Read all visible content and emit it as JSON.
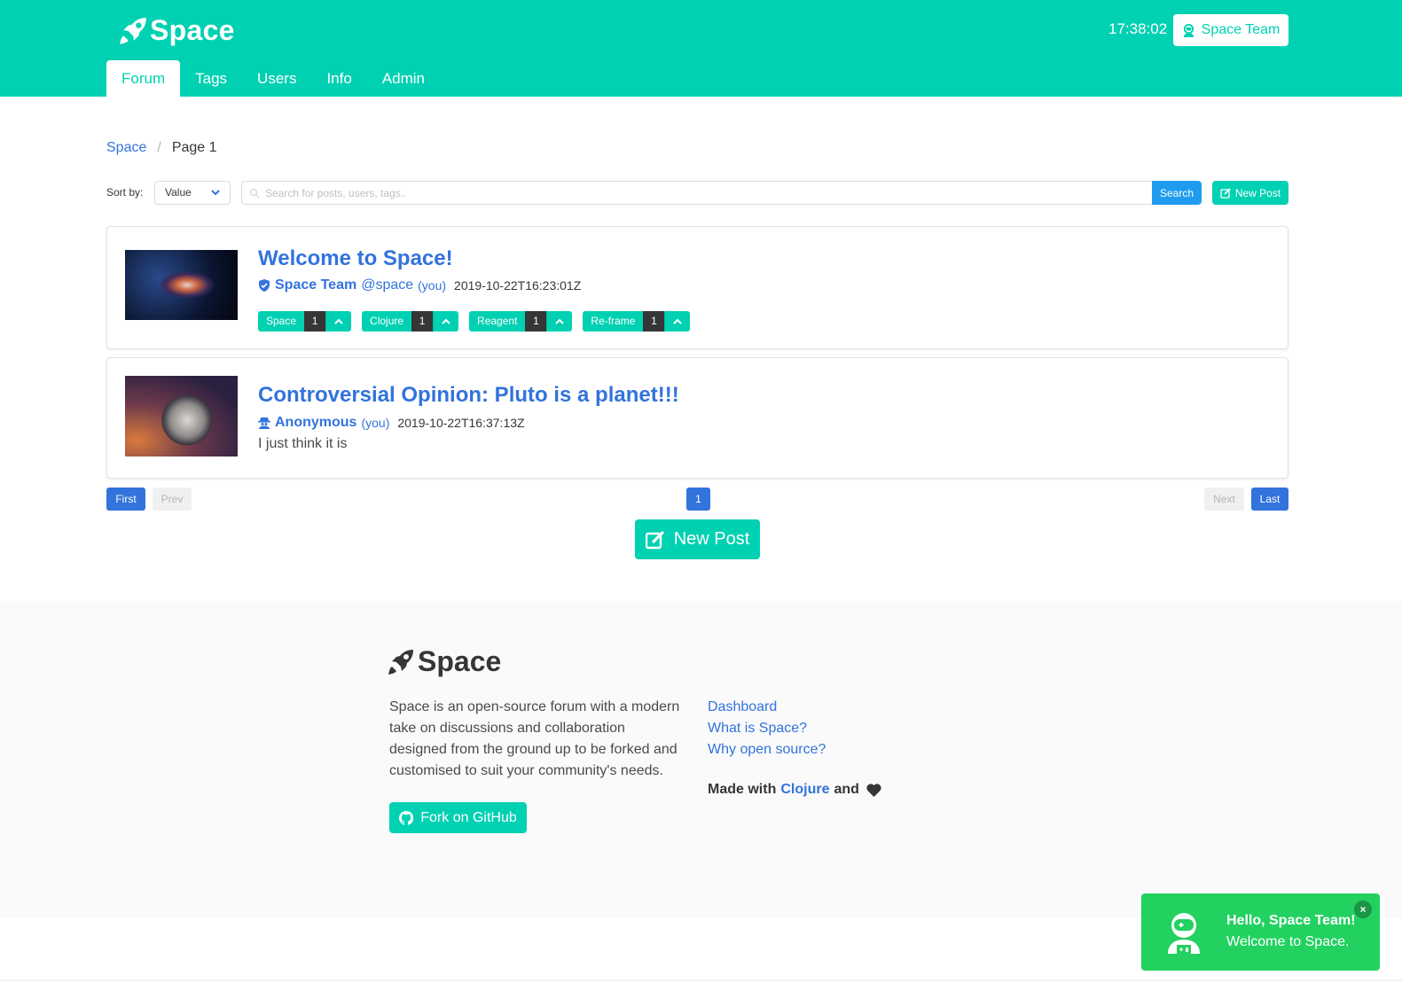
{
  "header": {
    "brand": "Space",
    "clock": "17:38:02",
    "user_button": "Space Team",
    "tabs": [
      {
        "label": "Forum",
        "active": true
      },
      {
        "label": "Tags"
      },
      {
        "label": "Users"
      },
      {
        "label": "Info"
      },
      {
        "label": "Admin"
      }
    ]
  },
  "breadcrumb": {
    "root": "Space",
    "separator": "/",
    "current": "Page 1"
  },
  "toolbar": {
    "sort_label": "Sort by:",
    "sort_value": "Value",
    "search_placeholder": "Search for posts, users, tags..",
    "search_button": "Search",
    "new_post": "New Post"
  },
  "posts": [
    {
      "title": "Welcome to Space!",
      "author": "Space Team",
      "handle": "@space",
      "you": "(you)",
      "timestamp": "2019-10-22T16:23:01Z",
      "tags": [
        {
          "name": "Space",
          "count": "1"
        },
        {
          "name": "Clojure",
          "count": "1"
        },
        {
          "name": "Reagent",
          "count": "1"
        },
        {
          "name": "Re-frame",
          "count": "1"
        }
      ]
    },
    {
      "title": "Controversial Opinion: Pluto is a planet!!!",
      "author": "Anonymous",
      "you": "(you)",
      "timestamp": "2019-10-22T16:37:13Z",
      "excerpt": "I just think it is"
    }
  ],
  "pagination": {
    "first": "First",
    "prev": "Prev",
    "current": "1",
    "next": "Next",
    "last": "Last"
  },
  "new_post_large": "New Post",
  "footer": {
    "brand": "Space",
    "description": "Space is an open-source forum with a modern take on discussions and collaboration designed from the ground up to be forked and customised to suit your community's needs.",
    "github_button": "Fork on GitHub",
    "links": [
      "Dashboard",
      "What is Space?",
      "Why open source?"
    ],
    "made_with": "Made with",
    "made_link": "Clojure",
    "made_and": "and"
  },
  "toast": {
    "title": "Hello, Space Team!",
    "message": "Welcome to Space.",
    "close": "×"
  },
  "colors": {
    "primary": "#00d1b2",
    "link": "#3273dc",
    "info": "#209cee",
    "success": "#23d160",
    "dark": "#363636"
  },
  "icons": [
    "rocket-icon",
    "user-astronaut-icon",
    "search-icon",
    "chevron-down-icon",
    "edit-icon",
    "verified-shield-icon",
    "user-secret-icon",
    "chevron-up-icon",
    "github-icon",
    "heart-icon"
  ]
}
